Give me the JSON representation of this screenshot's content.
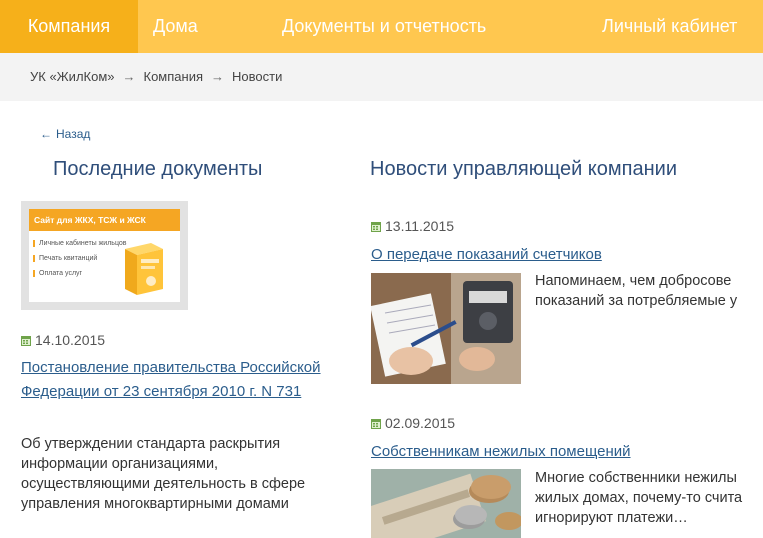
{
  "nav": {
    "items": [
      {
        "label": "Компания",
        "active": true
      },
      {
        "label": "Дома",
        "active": false
      },
      {
        "label": "Документы и отчетность",
        "active": false
      },
      {
        "label": "Личный кабинет",
        "active": false
      }
    ]
  },
  "breadcrumb": {
    "items": [
      "УК «ЖилКом»",
      "Компания",
      "Новости"
    ],
    "separator": "→"
  },
  "back": {
    "arrow": "←",
    "label": "Назад"
  },
  "left": {
    "heading": "Последние документы",
    "banner": {
      "title": "Сайт для ЖКХ, ТСЖ и ЖСК",
      "items": [
        "Личные кабинеты жильцов",
        "Печать квитанций",
        "Оплата услуг"
      ]
    },
    "doc": {
      "date": "14.10.2015",
      "title": "Постановление правительства Российской Федерации от 23 сентября 2010 г. N 731",
      "summary": "Об утверждении стандарта раскрытия информации организациями, осуществляющими деятельность в сфере управления многоквартирными домами"
    }
  },
  "right": {
    "heading": "Новости управляющей компании",
    "news": [
      {
        "date": "13.11.2015",
        "title": "О передаче показаний счетчиков",
        "text_line1": "Напоминаем, чем добросове",
        "text_line2": "показаний за потребляемые у"
      },
      {
        "date": "02.09.2015",
        "title": "Собственникам нежилых помещений",
        "text_line1": "Многие собственники нежилы",
        "text_line2": "жилых домах, почему-то счита",
        "text_line3": "игнорируют платежи…"
      }
    ]
  },
  "colors": {
    "nav_bg": "#ffc74f",
    "nav_active": "#f6b01a",
    "link": "#2b5d8c",
    "heading": "#2f4e7a",
    "accent": "#f5a623"
  },
  "icons": {
    "date": "calendar-icon",
    "back": "arrow-left-icon"
  }
}
